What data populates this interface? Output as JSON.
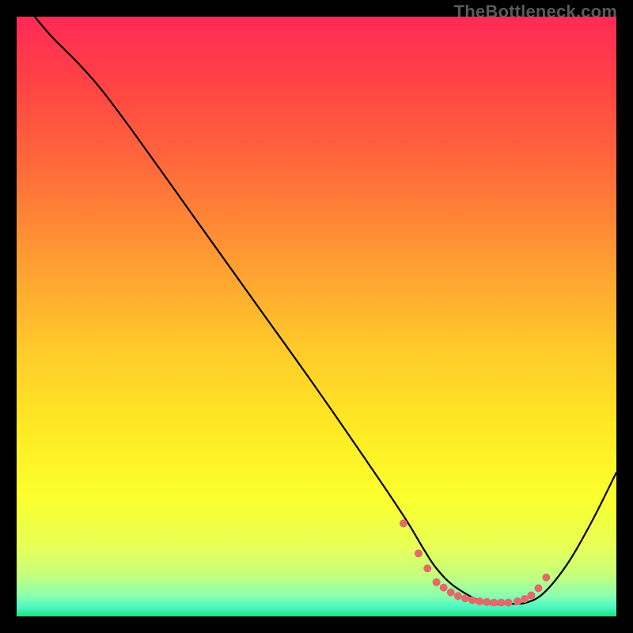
{
  "watermark": "TheBottleneck.com",
  "chart_data": {
    "type": "line",
    "title": "",
    "xlabel": "",
    "ylabel": "",
    "xlim": [
      0,
      100
    ],
    "ylim": [
      0,
      100
    ],
    "gradient_stops": [
      {
        "offset": 0,
        "color": "#ff2a55"
      },
      {
        "offset": 0.1,
        "color": "#ff4046"
      },
      {
        "offset": 0.25,
        "color": "#ff6a3a"
      },
      {
        "offset": 0.4,
        "color": "#ff9a33"
      },
      {
        "offset": 0.55,
        "color": "#ffc92b"
      },
      {
        "offset": 0.68,
        "color": "#ffe824"
      },
      {
        "offset": 0.8,
        "color": "#fbff2c"
      },
      {
        "offset": 0.88,
        "color": "#e9ff55"
      },
      {
        "offset": 0.93,
        "color": "#c6ff7a"
      },
      {
        "offset": 0.965,
        "color": "#8dffb0"
      },
      {
        "offset": 0.985,
        "color": "#4cf7c2"
      },
      {
        "offset": 1.0,
        "color": "#17e57e"
      }
    ],
    "series": [
      {
        "name": "bottleneck-curve",
        "color": "#000000",
        "x": [
          3,
          6,
          10,
          14,
          20,
          30,
          40,
          50,
          60,
          65,
          68,
          70,
          73,
          78,
          82,
          85,
          88,
          92,
          96,
          100
        ],
        "y": [
          100,
          96.5,
          92.5,
          88,
          80,
          66,
          52,
          38,
          23.5,
          16,
          11,
          8,
          5,
          2.3,
          2.1,
          2.3,
          4,
          9,
          16,
          24
        ]
      }
    ],
    "highlight": {
      "name": "optimal-region",
      "color": "#e26a6a",
      "radius": 5,
      "x": [
        64.5,
        67,
        68.5,
        70,
        71.2,
        72.4,
        73.6,
        74.8,
        76,
        77.2,
        78.4,
        79.6,
        80.8,
        82,
        83.5,
        84.7,
        85.8,
        87.0,
        88.3
      ],
      "y": [
        15.5,
        10.5,
        8,
        5.7,
        4.8,
        4,
        3.4,
        3,
        2.7,
        2.5,
        2.4,
        2.3,
        2.3,
        2.3,
        2.5,
        2.9,
        3.5,
        4.7,
        6.5
      ]
    }
  }
}
